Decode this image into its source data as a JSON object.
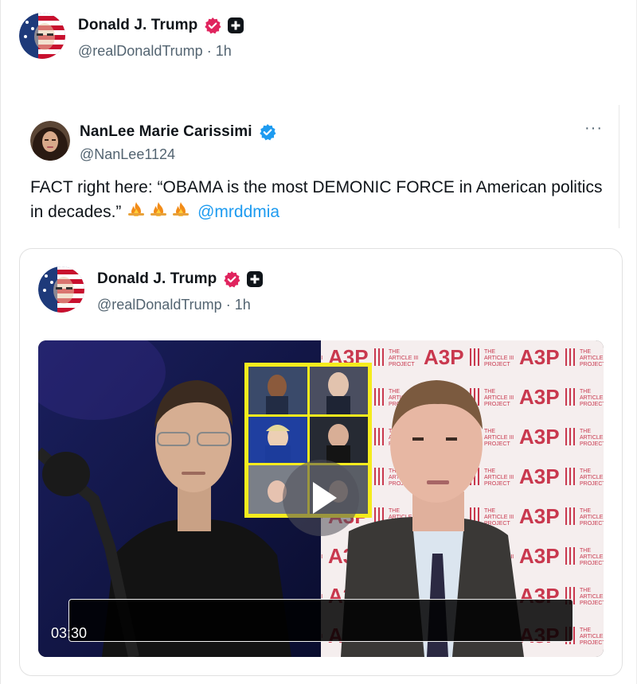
{
  "post": {
    "author_name": "Donald J. Trump",
    "handle": "@realDonaldTrump",
    "separator": "·",
    "time": "1h",
    "avatar_icon": "flag-portrait-avatar",
    "verified_icon": "verified-badge-red",
    "affiliate_icon": "affiliate-badge"
  },
  "quoted_post": {
    "author_name": "NanLee Marie Carissimi",
    "handle": "@NanLee1124",
    "verified_icon": "verified-badge-blue",
    "more_label": "···",
    "text": "FACT right here: “OBAMA is the most DEMONIC FORCE in American politics in decades.”",
    "emojis": [
      "fire-emoji",
      "fire-emoji",
      "fire-emoji"
    ],
    "mention": "@mrddmia"
  },
  "embedded_post": {
    "author_name": "Donald J. Trump",
    "handle": "@realDonaldTrump",
    "separator": "·",
    "time": "1h",
    "video": {
      "duration": "03:30",
      "play_icon": "play-icon",
      "backdrop_text": [
        "A3P",
        "THE ARTICLE III PROJECT"
      ]
    }
  },
  "colors": {
    "verified_red": "#e0245e",
    "verified_blue": "#1d9bf0",
    "link": "#1d9bf0",
    "handle_gray": "#536471",
    "backdrop_red": "#c9384e",
    "highlight_yellow": "#f5ec1d"
  }
}
